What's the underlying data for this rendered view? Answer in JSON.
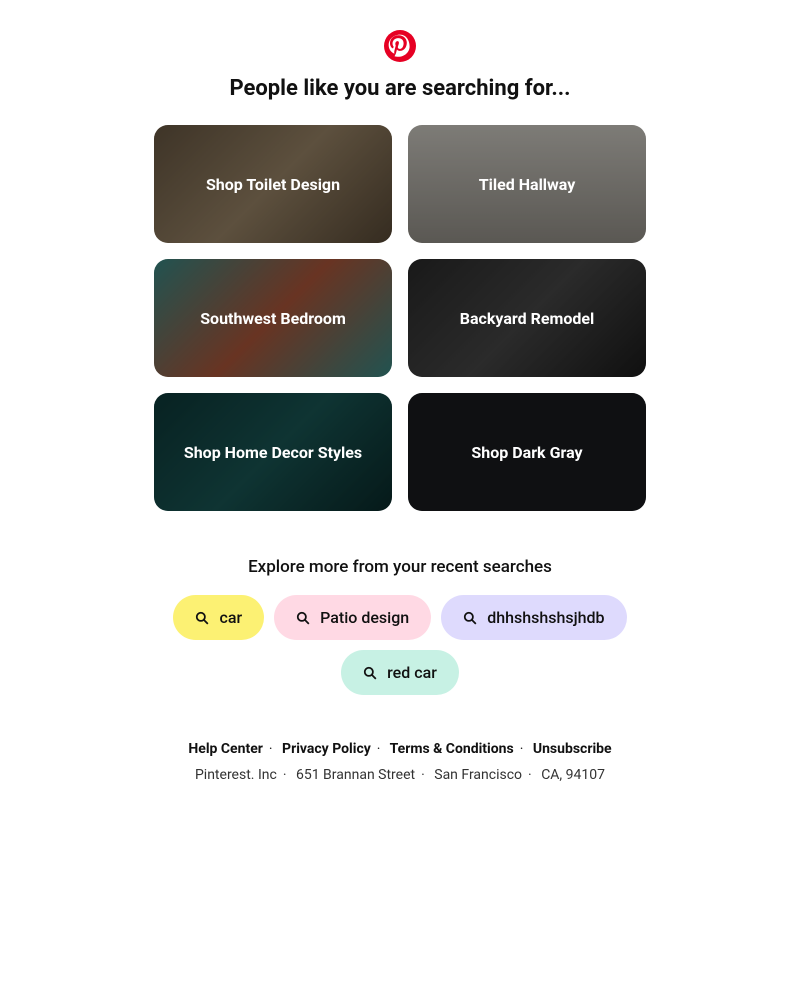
{
  "heading": "People like you are searching for...",
  "tiles": [
    {
      "label": "Shop Toilet Design"
    },
    {
      "label": "Tiled Hallway"
    },
    {
      "label": "Southwest Bedroom"
    },
    {
      "label": "Backyard Remodel"
    },
    {
      "label": "Shop Home Decor Styles"
    },
    {
      "label": "Shop Dark Gray"
    }
  ],
  "subheading": "Explore more from your recent searches",
  "pills": [
    {
      "label": "car",
      "color": "#fcf173"
    },
    {
      "label": "Patio design",
      "color": "#ffd9e4"
    },
    {
      "label": "dhhshshshsjhdb",
      "color": "#dedafd"
    },
    {
      "label": "red car",
      "color": "#c7f1e4"
    }
  ],
  "footer": {
    "links": [
      "Help Center",
      "Privacy Policy",
      "Terms & Conditions",
      "Unsubscribe"
    ],
    "address": [
      "Pinterest. Inc",
      "651 Brannan Street",
      "San Francisco",
      "CA, 94107"
    ]
  }
}
